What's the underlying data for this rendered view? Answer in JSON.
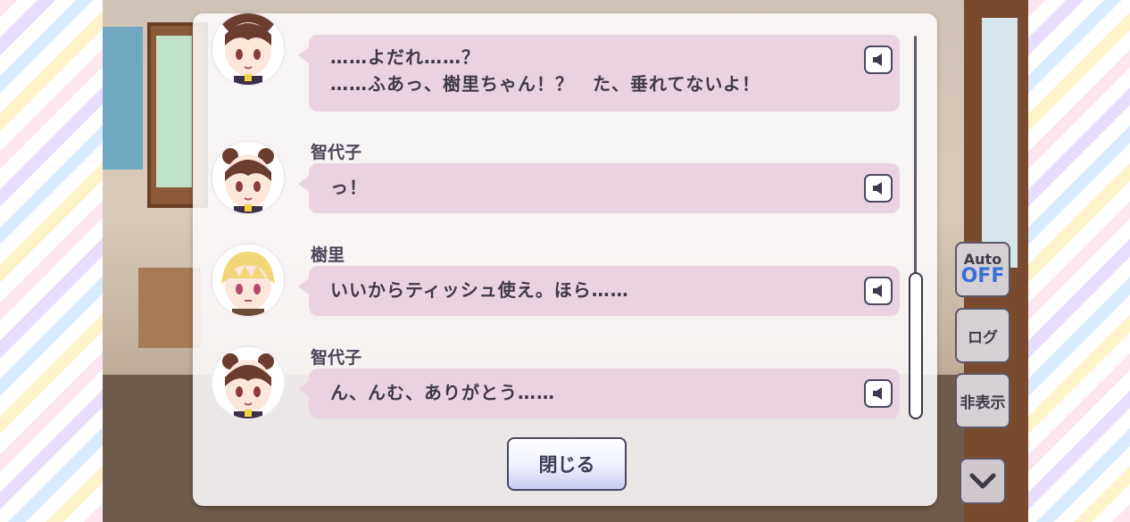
{
  "dialog": {
    "close_label": "閉じる",
    "entries": [
      {
        "speaker": "",
        "lines": [
          "……よだれ……？",
          "……ふあっ、樹里ちゃん！？　た、垂れてないよ！"
        ],
        "avatar": "chiyoko-avatar"
      },
      {
        "speaker": "智代子",
        "lines": [
          "っ！"
        ],
        "avatar": "chiyoko-avatar"
      },
      {
        "speaker": "樹里",
        "lines": [
          "いいからティッシュ使え。ほら……"
        ],
        "avatar": "juri-avatar"
      },
      {
        "speaker": "智代子",
        "lines": [
          "ん、んむ、ありがとう……"
        ],
        "avatar": "chiyoko-avatar"
      }
    ]
  },
  "side_controls": {
    "auto_label": "Auto",
    "auto_state": "OFF",
    "log_label": "ログ",
    "hide_label": "非表示"
  },
  "colors": {
    "bubble": "#ead3e0",
    "auto_state": "#3a6fd8",
    "button_border": "#4a4860"
  },
  "icons": {
    "voice": "speaker-icon",
    "chevron": "chevron-down-icon"
  }
}
